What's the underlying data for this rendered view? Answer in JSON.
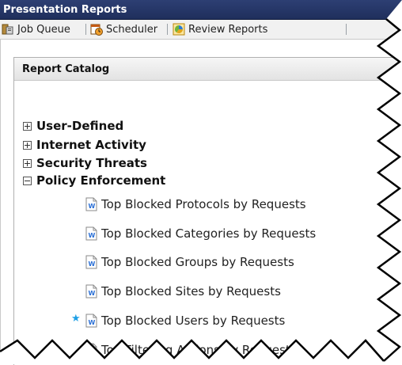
{
  "window": {
    "title": "Presentation Reports"
  },
  "toolbar": {
    "items": [
      {
        "label": "Job Queue",
        "icon": "job-queue-icon"
      },
      {
        "label": "Scheduler",
        "icon": "scheduler-icon"
      },
      {
        "label": "Review Reports",
        "icon": "review-reports-icon"
      }
    ]
  },
  "catalog": {
    "title": "Report Catalog",
    "categories": [
      {
        "label": "User-Defined",
        "state": "collapsed"
      },
      {
        "label": "Internet Activity",
        "state": "collapsed"
      },
      {
        "label": "Security Threats",
        "state": "collapsed"
      },
      {
        "label": "Policy Enforcement",
        "state": "expanded"
      }
    ],
    "reports": [
      {
        "label": "Top Blocked Protocols by Requests",
        "starred": false
      },
      {
        "label": "Top Blocked Categories by Requests",
        "starred": false
      },
      {
        "label": "Top Blocked Groups by Requests",
        "starred": false
      },
      {
        "label": "Top Blocked Sites by Requests",
        "starred": false
      },
      {
        "label": "Top Blocked Users by Requests",
        "starred": true
      },
      {
        "label": "Top Filtering Actions by Requests",
        "starred": false
      }
    ]
  },
  "colors": {
    "titlebar": "#2d3f73",
    "star": "#1ea0e6",
    "doc_icon": "#2a6fd6"
  }
}
